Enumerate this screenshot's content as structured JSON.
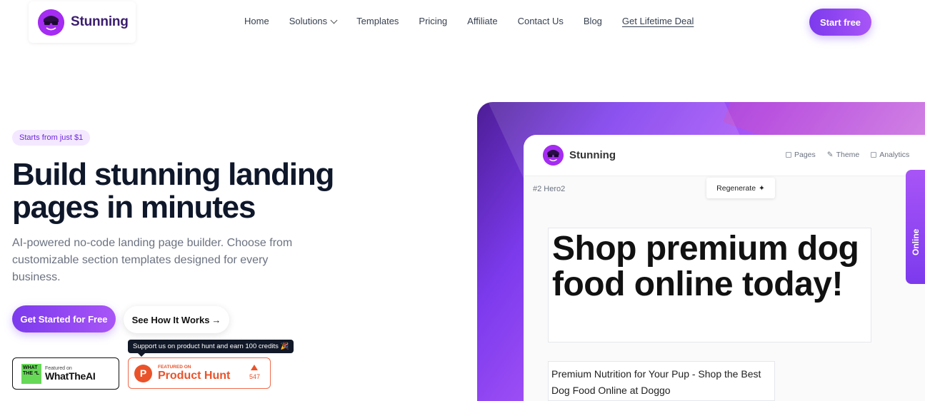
{
  "brand": {
    "name": "Stunning"
  },
  "nav": {
    "items": [
      {
        "label": "Home"
      },
      {
        "label": "Solutions"
      },
      {
        "label": "Templates"
      },
      {
        "label": "Pricing"
      },
      {
        "label": "Affiliate"
      },
      {
        "label": "Contact Us"
      },
      {
        "label": "Blog"
      },
      {
        "label": "Get Lifetime Deal"
      }
    ],
    "cta": "Start free"
  },
  "hero": {
    "pill": "Starts from just $1",
    "title": "Build stunning landing pages in minutes",
    "subtitle": "AI-powered no-code landing page builder. Choose from customizable section templates designed for every business.",
    "primary_cta": "Get Started for Free",
    "secondary_cta": "See How It Works",
    "secondary_arrow": "→",
    "tooltip": "Support us on product hunt and earn 100 credits 🎉",
    "badges": {
      "wta": {
        "logo": "WHAT THE *L",
        "small": "Featured on",
        "name": "WhatTheAI"
      },
      "ph": {
        "letter": "P",
        "small": "FEATURED ON",
        "name": "Product Hunt",
        "votes": "547"
      }
    }
  },
  "mockup": {
    "brand": "Stunning",
    "tabs": [
      {
        "label": "Pages",
        "icon": "pages-icon"
      },
      {
        "label": "Theme",
        "icon": "brush-icon"
      },
      {
        "label": "Analytics",
        "icon": "analytics-icon"
      }
    ],
    "crumb": "#2 Hero2",
    "regenerate": "Regenerate",
    "headline": "Shop premium dog food online today!",
    "subheadline": "Premium Nutrition for Your Pup - Shop the Best Dog Food Online at Doggo",
    "online_tab": "Online"
  },
  "colors": {
    "accent": "#8b5cf6",
    "accent_dark": "#7c3aed",
    "ph": "#ea532a",
    "wta_green": "#66d957"
  }
}
